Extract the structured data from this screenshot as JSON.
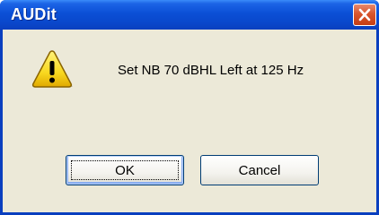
{
  "window": {
    "title": "AUDit"
  },
  "dialog": {
    "message": "Set  NB 70 dBHL Left at 125 Hz",
    "icon": "warning-icon"
  },
  "buttons": {
    "ok_label": "OK",
    "cancel_label": "Cancel",
    "close_icon": "close-icon"
  },
  "colors": {
    "titlebar": "#0a48cc",
    "client_bg": "#ece9d8",
    "close_button": "#d8552d",
    "warning_yellow": "#f8d820"
  }
}
